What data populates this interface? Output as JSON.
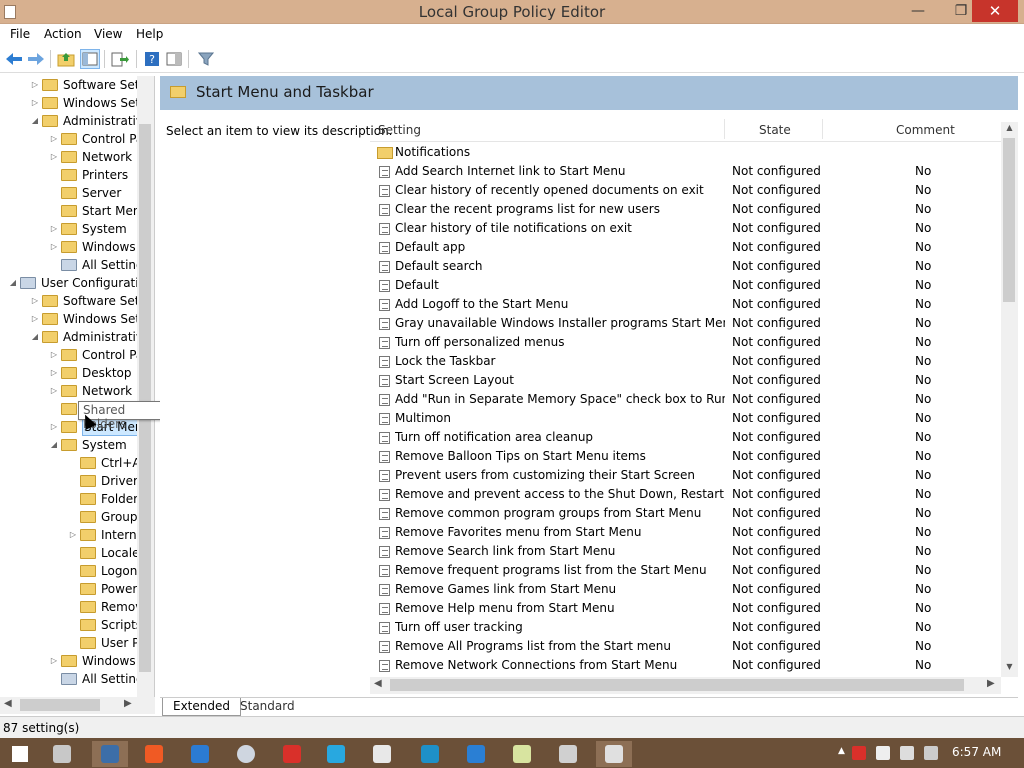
{
  "window": {
    "title": "Local Group Policy Editor",
    "minimize": "—",
    "restore": "❐",
    "close": "✕"
  },
  "menu": [
    "File",
    "Action",
    "View",
    "Help"
  ],
  "toolbar": {
    "icons": [
      "back-arrow-icon",
      "forward-arrow-icon",
      "up-folder-icon",
      "show-hide-tree-icon",
      "export-list-icon",
      "help-icon",
      "properties-pane-icon",
      "filter-icon"
    ]
  },
  "tree": [
    {
      "label": "Software Setti",
      "indent": 2,
      "arrow": "▷",
      "folder": true
    },
    {
      "label": "Windows Sett",
      "indent": 2,
      "arrow": "▷",
      "folder": true
    },
    {
      "label": "Administrative",
      "indent": 2,
      "arrow": "◢",
      "folder": true
    },
    {
      "label": "Control Pa",
      "indent": 3,
      "arrow": "▷",
      "folder": true
    },
    {
      "label": "Network",
      "indent": 3,
      "arrow": "▷",
      "folder": true
    },
    {
      "label": "Printers",
      "indent": 3,
      "arrow": "",
      "folder": true
    },
    {
      "label": "Server",
      "indent": 3,
      "arrow": "",
      "folder": true
    },
    {
      "label": "Start Menu",
      "indent": 3,
      "arrow": "",
      "folder": true
    },
    {
      "label": "System",
      "indent": 3,
      "arrow": "▷",
      "folder": true
    },
    {
      "label": "Windows",
      "indent": 3,
      "arrow": "▷",
      "folder": true
    },
    {
      "label": "All Setting",
      "indent": 3,
      "arrow": "",
      "folder": false
    },
    {
      "label": "User Configuratio",
      "indent": 1,
      "arrow": "◢",
      "folder": false
    },
    {
      "label": "Software Setti",
      "indent": 2,
      "arrow": "▷",
      "folder": true
    },
    {
      "label": "Windows Sett",
      "indent": 2,
      "arrow": "▷",
      "folder": true
    },
    {
      "label": "Administrative",
      "indent": 2,
      "arrow": "◢",
      "folder": true
    },
    {
      "label": "Control Pa",
      "indent": 3,
      "arrow": "▷",
      "folder": true
    },
    {
      "label": "Desktop",
      "indent": 3,
      "arrow": "▷",
      "folder": true
    },
    {
      "label": "Network",
      "indent": 3,
      "arrow": "▷",
      "folder": true
    },
    {
      "label": "",
      "indent": 3,
      "arrow": "",
      "folder": true
    },
    {
      "label": "Start Menu",
      "indent": 3,
      "arrow": "▷",
      "folder": true,
      "selected": true
    },
    {
      "label": "System",
      "indent": 3,
      "arrow": "◢",
      "folder": true
    },
    {
      "label": "Ctrl+A",
      "indent": 4,
      "arrow": "",
      "folder": true
    },
    {
      "label": "Driver",
      "indent": 4,
      "arrow": "",
      "folder": true
    },
    {
      "label": "Folder",
      "indent": 4,
      "arrow": "",
      "folder": true
    },
    {
      "label": "Group",
      "indent": 4,
      "arrow": "",
      "folder": true
    },
    {
      "label": "Interne",
      "indent": 4,
      "arrow": "▷",
      "folder": true
    },
    {
      "label": "Locale",
      "indent": 4,
      "arrow": "",
      "folder": true
    },
    {
      "label": "Logon",
      "indent": 4,
      "arrow": "",
      "folder": true
    },
    {
      "label": "Power",
      "indent": 4,
      "arrow": "",
      "folder": true
    },
    {
      "label": "Remov",
      "indent": 4,
      "arrow": "",
      "folder": true
    },
    {
      "label": "Scripts",
      "indent": 4,
      "arrow": "",
      "folder": true
    },
    {
      "label": "User Pr",
      "indent": 4,
      "arrow": "",
      "folder": true
    },
    {
      "label": "Windows",
      "indent": 3,
      "arrow": "▷",
      "folder": true
    },
    {
      "label": "All Setting",
      "indent": 3,
      "arrow": "",
      "folder": false
    }
  ],
  "tooltip": "Shared Folders",
  "section": {
    "title": "Start Menu and Taskbar",
    "description": "Select an item to view its description."
  },
  "columns": {
    "setting": "Setting",
    "state": "State",
    "comment": "Comment"
  },
  "rows": [
    {
      "name": "Notifications",
      "state": "",
      "comment": "",
      "folder": true
    },
    {
      "name": "Add Search Internet link to Start Menu",
      "state": "Not configured",
      "comment": "No"
    },
    {
      "name": "Clear history of recently opened documents on exit",
      "state": "Not configured",
      "comment": "No"
    },
    {
      "name": "Clear the recent programs list for new users",
      "state": "Not configured",
      "comment": "No"
    },
    {
      "name": "Clear history of tile notifications on exit",
      "state": "Not configured",
      "comment": "No"
    },
    {
      "name": "Default app",
      "state": "Not configured",
      "comment": "No"
    },
    {
      "name": "Default search",
      "state": "Not configured",
      "comment": "No"
    },
    {
      "name": "Default",
      "state": "Not configured",
      "comment": "No"
    },
    {
      "name": "Add Logoff to the Start Menu",
      "state": "Not configured",
      "comment": "No"
    },
    {
      "name": "Gray unavailable Windows Installer programs Start Menu sh...",
      "state": "Not configured",
      "comment": "No"
    },
    {
      "name": "Turn off personalized menus",
      "state": "Not configured",
      "comment": "No"
    },
    {
      "name": "Lock the Taskbar",
      "state": "Not configured",
      "comment": "No"
    },
    {
      "name": "Start Screen Layout",
      "state": "Not configured",
      "comment": "No"
    },
    {
      "name": "Add \"Run in Separate Memory Space\" check box to Run dial...",
      "state": "Not configured",
      "comment": "No"
    },
    {
      "name": "Multimon",
      "state": "Not configured",
      "comment": "No"
    },
    {
      "name": "Turn off notification area cleanup",
      "state": "Not configured",
      "comment": "No"
    },
    {
      "name": "Remove Balloon Tips on Start Menu items",
      "state": "Not configured",
      "comment": "No"
    },
    {
      "name": "Prevent users from customizing their Start Screen",
      "state": "Not configured",
      "comment": "No"
    },
    {
      "name": "Remove and prevent access to the Shut Down, Restart, Sleep...",
      "state": "Not configured",
      "comment": "No"
    },
    {
      "name": "Remove common program groups from Start Menu",
      "state": "Not configured",
      "comment": "No"
    },
    {
      "name": "Remove Favorites menu from Start Menu",
      "state": "Not configured",
      "comment": "No"
    },
    {
      "name": "Remove Search link from Start Menu",
      "state": "Not configured",
      "comment": "No"
    },
    {
      "name": "Remove frequent programs list from the Start Menu",
      "state": "Not configured",
      "comment": "No"
    },
    {
      "name": "Remove Games link from Start Menu",
      "state": "Not configured",
      "comment": "No"
    },
    {
      "name": "Remove Help menu from Start Menu",
      "state": "Not configured",
      "comment": "No"
    },
    {
      "name": "Turn off user tracking",
      "state": "Not configured",
      "comment": "No"
    },
    {
      "name": "Remove All Programs list from the Start menu",
      "state": "Not configured",
      "comment": "No"
    },
    {
      "name": "Remove Network Connections from Start Menu",
      "state": "Not configured",
      "comment": "No"
    }
  ],
  "tabs": [
    "Extended",
    "Standard"
  ],
  "status": "87 setting(s)",
  "taskbar": {
    "apps": [
      {
        "icon": "start-windows-icon",
        "color": "#ffffff"
      },
      {
        "icon": "film-app-icon",
        "color": "#c8c8c8"
      },
      {
        "icon": "desktop-app-icon",
        "color": "#3c6ea8",
        "active": true
      },
      {
        "icon": "brave-browser-icon",
        "color": "#f05a24"
      },
      {
        "icon": "maxthon-browser-icon",
        "color": "#2b7bd3"
      },
      {
        "icon": "globe-app-icon",
        "color": "#cfd6e0"
      },
      {
        "icon": "vivaldi-browser-icon",
        "color": "#d9302a"
      },
      {
        "icon": "bird-app-icon",
        "color": "#28a8e0"
      },
      {
        "icon": "clapper-app-icon",
        "color": "#e8e8e8"
      },
      {
        "icon": "tiles-app-icon",
        "color": "#1e90c8"
      },
      {
        "icon": "internet-explorer-icon",
        "color": "#2a7fd4"
      },
      {
        "icon": "notes-app-icon",
        "color": "#d8e4a0"
      },
      {
        "icon": "window-app-icon",
        "color": "#d0d0d0"
      },
      {
        "icon": "policy-editor-icon",
        "color": "#e0e0e0",
        "active": true
      }
    ],
    "time": "6:57 AM"
  }
}
